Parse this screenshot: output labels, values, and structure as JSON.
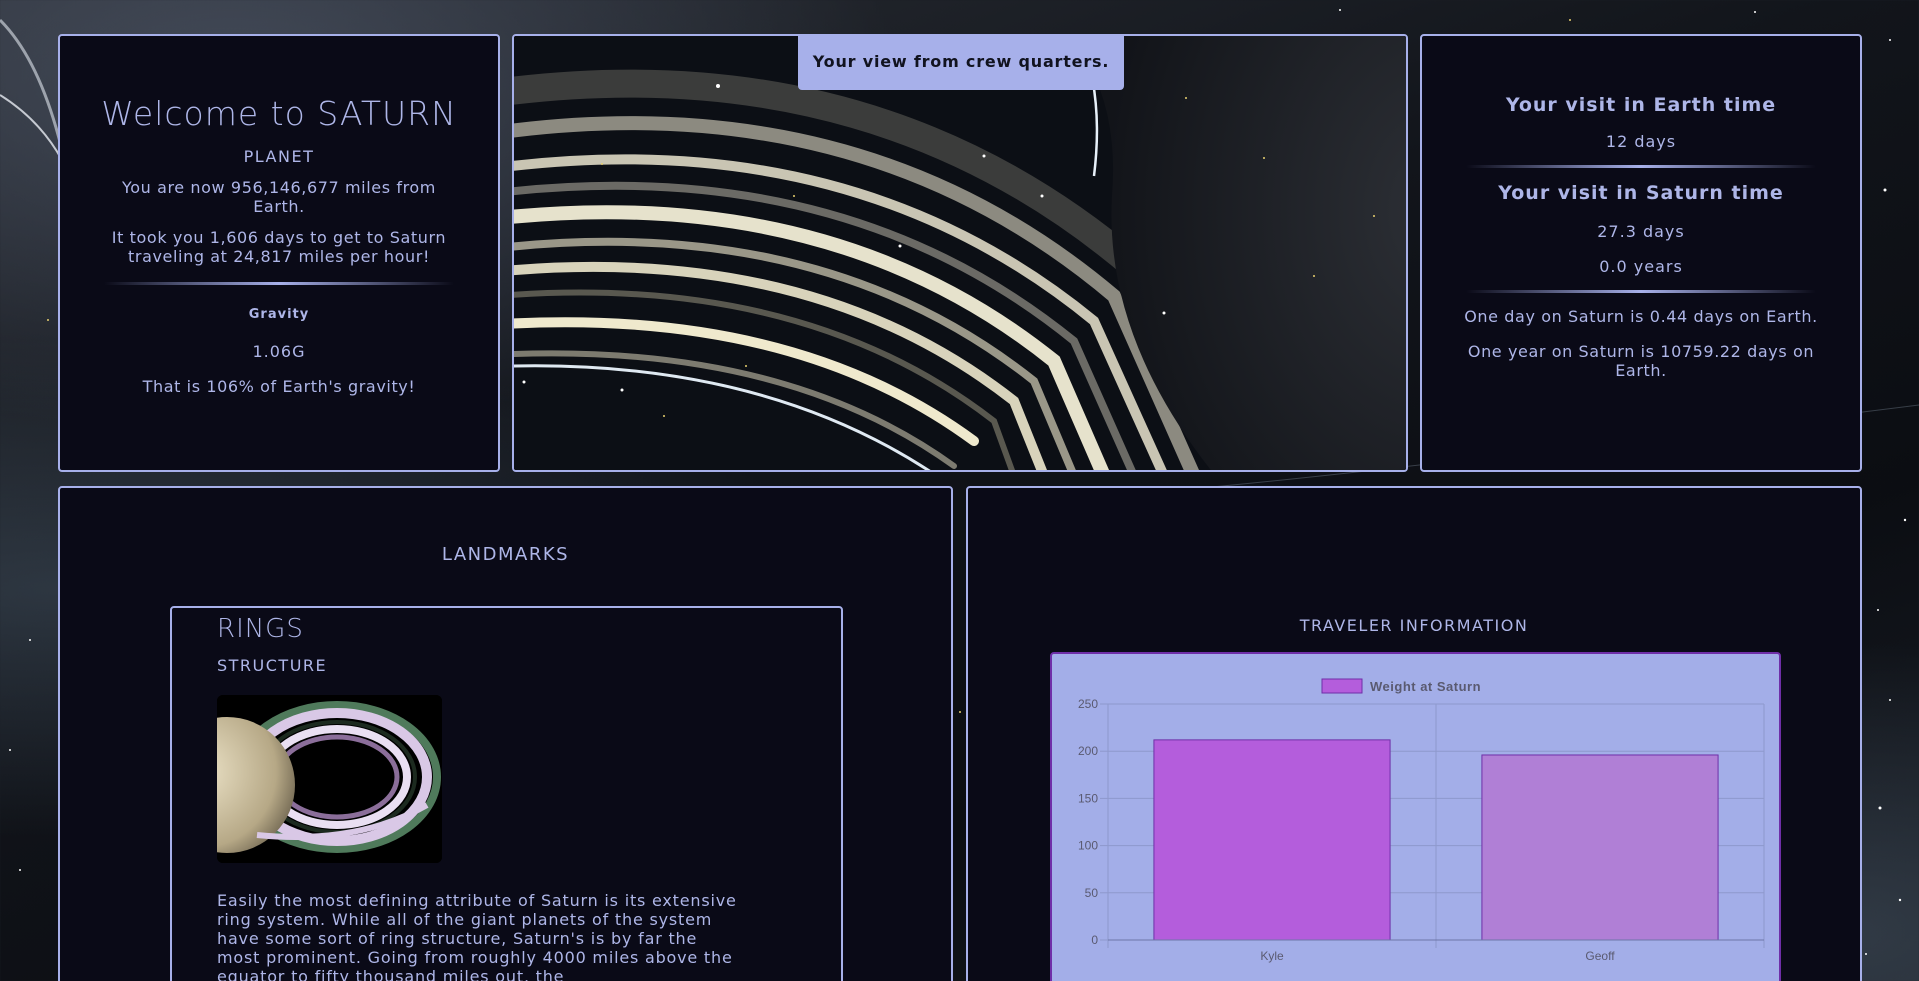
{
  "welcome": {
    "title": "Welcome to SATURN",
    "subtitle": "PLANET",
    "distance": "You are now 956,146,677 miles from Earth.",
    "travel": "It took you 1,606 days to get to Saturn traveling at 24,817 miles per hour!",
    "gravity_title": "Gravity",
    "gravity_value": "1.06G",
    "gravity_note": "That is 106% of Earth's gravity!"
  },
  "view": {
    "caption": "Your view from crew quarters."
  },
  "time": {
    "earth_title": "Your visit in Earth time",
    "earth_days": "12 days",
    "saturn_title": "Your visit in Saturn time",
    "saturn_days": "27.3 days",
    "saturn_years": "0.0 years",
    "day_note": "One day on Saturn is 0.44 days on Earth.",
    "year_note": "One year on Saturn is 10759.22 days on Earth."
  },
  "landmarks": {
    "title": "LANDMARKS",
    "card": {
      "name": "RINGS",
      "category": "STRUCTURE",
      "description": "Easily the most defining attribute of Saturn is its extensive ring system. While all of the giant planets of the system have some sort of ring structure, Saturn's is by far the most prominent. Going from roughly 4000 miles above the equator to fifty thousand miles out, the"
    }
  },
  "traveler": {
    "title": "TRAVELER INFORMATION"
  },
  "chart_data": {
    "type": "bar",
    "categories": [
      "Kyle",
      "Geoff"
    ],
    "series": [
      {
        "name": "Weight at Saturn",
        "values": [
          212,
          196
        ],
        "colors": [
          "#b45ddc",
          "#b07fd6"
        ]
      }
    ],
    "ylim": [
      0,
      250
    ],
    "yticks": [
      0,
      50,
      100,
      150,
      200,
      250
    ],
    "legend": "top-center",
    "grid": true,
    "background": "#a3aee8"
  }
}
